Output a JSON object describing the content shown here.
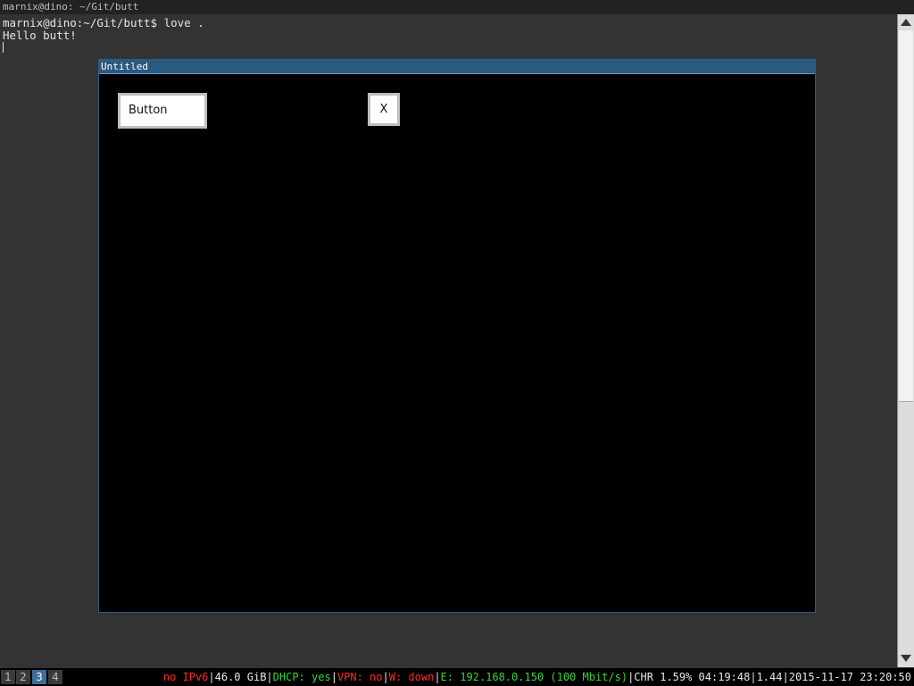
{
  "terminal": {
    "title": "marnix@dino: ~/Git/butt",
    "lines": [
      "marnix@dino:~/Git/butt$ love .",
      "Hello butt!"
    ]
  },
  "app_window": {
    "title": "Untitled",
    "button_label": "Button",
    "close_label": "X"
  },
  "workspaces": [
    "1",
    "2",
    "3",
    "4"
  ],
  "status": {
    "ipv6": "no IPv6",
    "disk": "46.0 GiB",
    "dhcp": "DHCP: yes",
    "vpn": "VPN: no",
    "wireless": "W: down",
    "ethernet": "E: 192.168.0.150 (100 Mbit/s)",
    "battery": "CHR 1.59% 04:19:48",
    "load": "1.44",
    "datetime": "2015-11-17 23:20:50"
  },
  "colors": {
    "active_workspace": "#3b6e9b",
    "window_titlebar": "#2a5a80",
    "status_bad": "#ff2a2a",
    "status_good": "#3cd33c"
  }
}
